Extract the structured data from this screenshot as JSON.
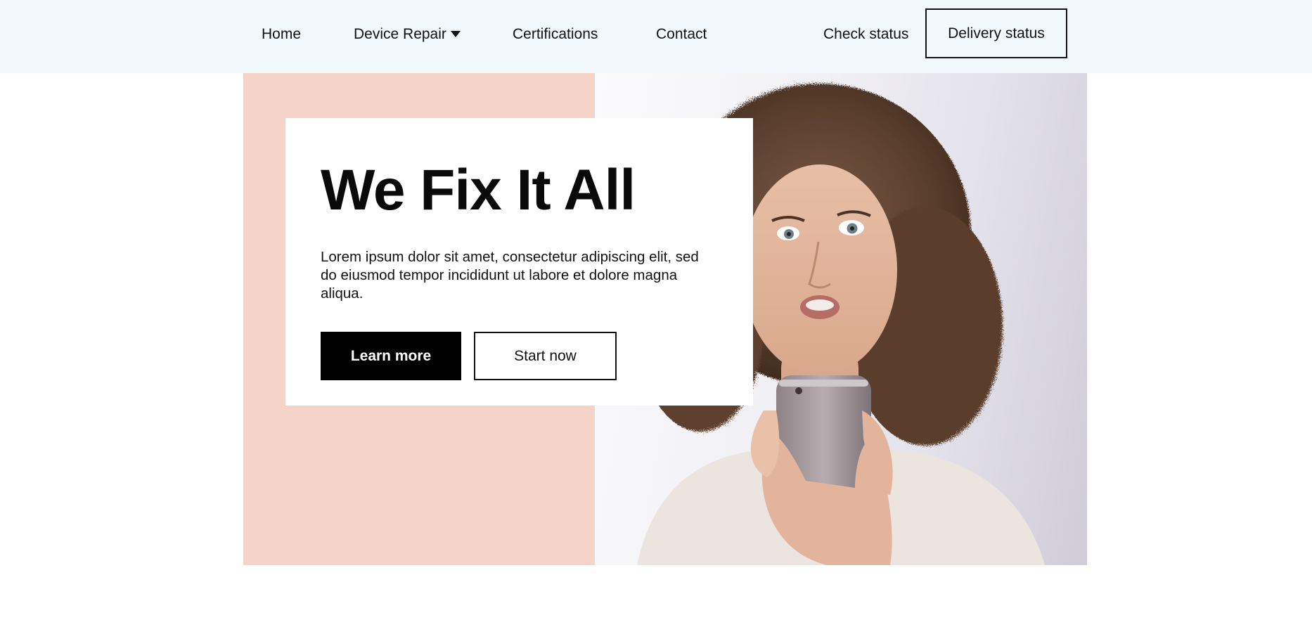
{
  "nav": {
    "home": "Home",
    "device_repair": "Device Repair",
    "certifications": "Certifications",
    "contact": "Contact",
    "check_status": "Check status",
    "delivery_status": "Delivery status"
  },
  "hero": {
    "title": "We Fix It All",
    "description": "Lorem ipsum dolor sit amet, consectetur adipiscing elit, sed do eiusmod tempor incididunt ut labore et dolore magna aliqua.",
    "learn_more": "Learn more",
    "start_now": "Start now",
    "image_subject": "woman-looking-at-phone"
  },
  "colors": {
    "nav_background": "#f1f9fc",
    "hero_accent": "#f6d3c9",
    "primary_button": "#000000",
    "text": "#111111"
  }
}
